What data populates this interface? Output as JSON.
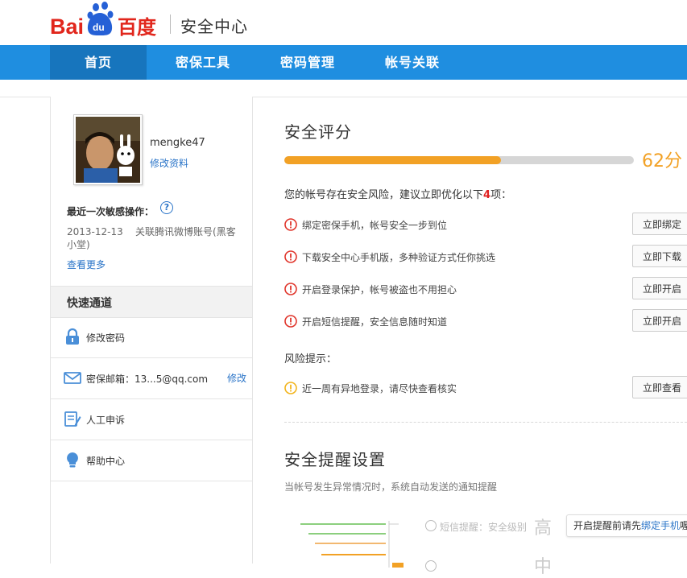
{
  "header": {
    "logo_text": "Bai百度",
    "site_title": "安全中心"
  },
  "nav": {
    "items": [
      {
        "label": "首页",
        "active": true
      },
      {
        "label": "密保工具",
        "active": false
      },
      {
        "label": "密码管理",
        "active": false
      },
      {
        "label": "帐号关联",
        "active": false
      }
    ]
  },
  "sidebar": {
    "username": "mengke47",
    "edit_profile": "修改资料",
    "last_op_title": "最近一次敏感操作：",
    "last_op_date": "2013-12-13",
    "last_op_desc": "关联腾讯微博账号(黑客小堂)",
    "view_more": "查看更多",
    "quick_title": "快速通道",
    "quick_items": [
      {
        "icon": "lock-icon",
        "label": "修改密码",
        "action": ""
      },
      {
        "icon": "mail-icon",
        "label": "密保邮箱：13...5@qq.com",
        "action": "修改"
      },
      {
        "icon": "appeal-icon",
        "label": "人工申诉",
        "action": ""
      },
      {
        "icon": "lightbulb-icon",
        "label": "帮助中心",
        "action": ""
      }
    ]
  },
  "security_score": {
    "title": "安全评分",
    "score_text": "62分",
    "score_value": 62,
    "risk_summary_pre": "您的帐号存在安全风险，建议立即优化以下",
    "risk_count": "4",
    "risk_summary_post": "项：",
    "tasks": [
      {
        "text": "绑定密保手机，帐号安全一步到位",
        "button": "立即绑定"
      },
      {
        "text": "下载安全中心手机版，多种验证方式任你挑选",
        "button": "立即下载"
      },
      {
        "text": "开启登录保护，帐号被盗也不用担心",
        "button": "立即开启"
      },
      {
        "text": "开启短信提醒，安全信息随时知道",
        "button": "立即开启"
      }
    ],
    "risk_tips_title": "风险提示：",
    "risk_tips": [
      {
        "text": "近一周有异地登录，请尽快查看核实",
        "button": "立即查看"
      }
    ]
  },
  "reminder": {
    "title": "安全提醒设置",
    "subtitle": "当帐号发生异常情况时，系统自动发送的通知提醒",
    "sms_label": "短信提醒：安全级别",
    "level_high": "高",
    "level_mid": "中",
    "tooltip_pre": "开启提醒前请先",
    "tooltip_link": "绑定手机",
    "tooltip_post": "喔"
  },
  "colors": {
    "nav_bg": "#1f8ee0",
    "nav_active": "#1775bd",
    "score": "#f2a125",
    "warn_red": "#e0352b",
    "warn_yellow": "#f2b41c",
    "link": "#2a74c8"
  }
}
